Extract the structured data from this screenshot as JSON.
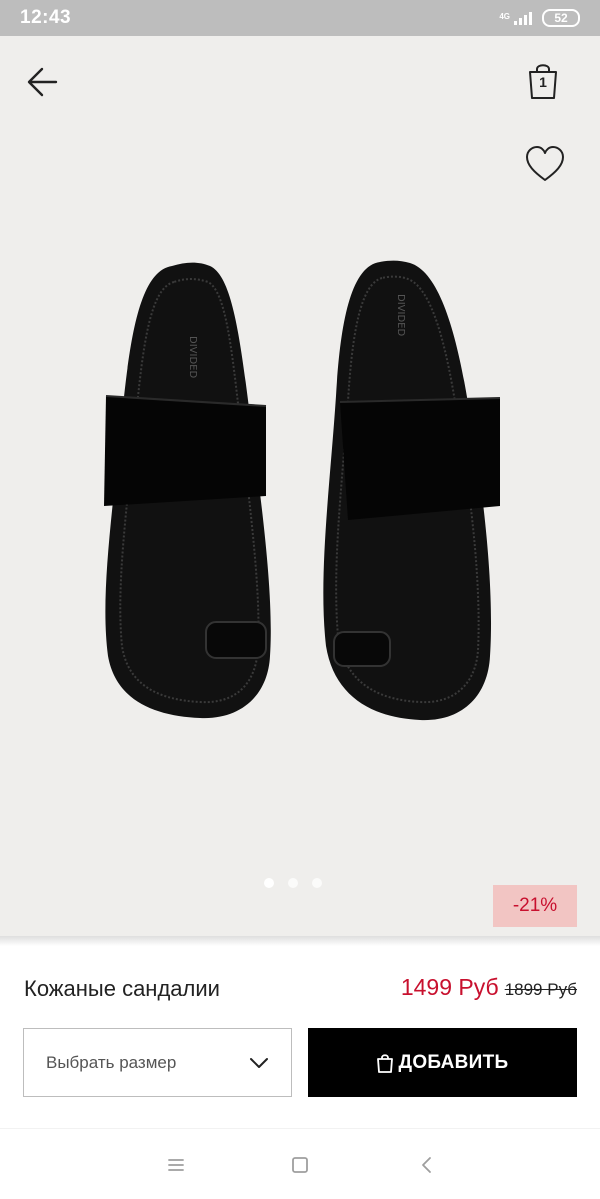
{
  "status_bar": {
    "time": "12:43",
    "network": "4G",
    "battery": "52"
  },
  "header": {
    "back_icon": "arrow-left-icon",
    "bag_icon": "shopping-bag-icon",
    "bag_count": "1",
    "favorite_icon": "heart-outline-icon"
  },
  "gallery": {
    "image": "black leather toe-ring sandals",
    "slide_count": 3,
    "active_slide": 1,
    "discount_badge": "-21%"
  },
  "product": {
    "name": "Кожаные сандалии",
    "price_current": "1499 Руб",
    "price_old": "1899 Руб"
  },
  "actions": {
    "size_select_label": "Выбрать размер",
    "size_chevron_icon": "chevron-down-icon",
    "add_button_label": "ДОБАВИТЬ",
    "add_button_icon": "shopping-bag-icon"
  },
  "system_nav": {
    "menu_icon": "menu-icon",
    "home_icon": "square-icon",
    "back_icon": "chevron-left-icon"
  },
  "colors": {
    "accent_sale": "#c8102e",
    "badge_bg": "#f2c5c3",
    "status_bar_bg": "#bdbdbd",
    "hero_bg": "#efeeec",
    "button_bg": "#000000"
  }
}
